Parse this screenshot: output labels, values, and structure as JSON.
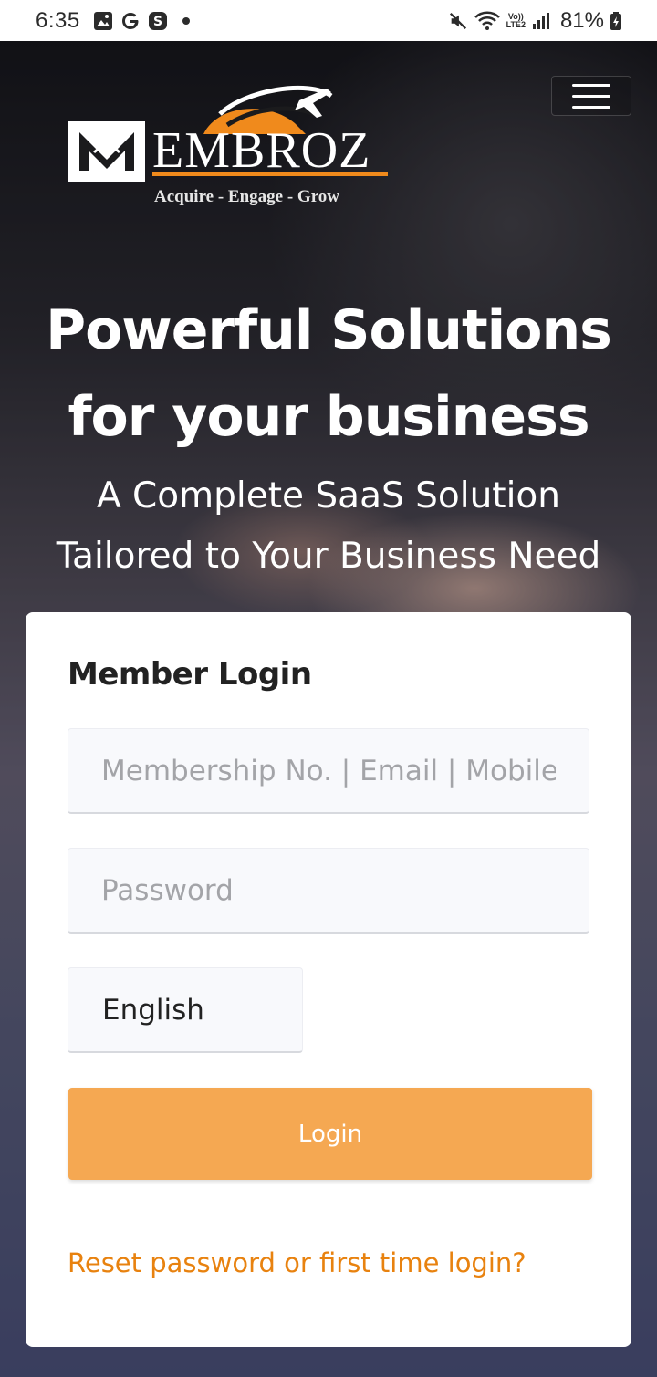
{
  "status_bar": {
    "time": "6:35",
    "left_icons": [
      "gallery-icon",
      "google-icon",
      "s-app-icon"
    ],
    "right_icons": [
      "mute-icon",
      "wifi-icon",
      "volte-icon",
      "signal-icon",
      "battery-icon"
    ],
    "volte_top": "Vo))",
    "volte_bottom": "LTE2",
    "battery": "81%"
  },
  "brand": {
    "name": "EMBROZ",
    "initial": "M",
    "tagline": "Acquire - Engage - Grow",
    "accent_color": "#f08a1c"
  },
  "hero": {
    "headline_line1": "Powerful Solutions",
    "headline_line2": "for your business",
    "subline_line1": "A Complete SaaS Solution",
    "subline_line2": "Tailored to Your Business Need"
  },
  "login": {
    "title": "Member Login",
    "username_placeholder": "Membership No. | Email | Mobile",
    "password_placeholder": "Password",
    "language": "English",
    "button_label": "Login",
    "reset_link": "Reset password or first time login?",
    "button_color": "#f5a852",
    "link_color": "#e8820f"
  }
}
